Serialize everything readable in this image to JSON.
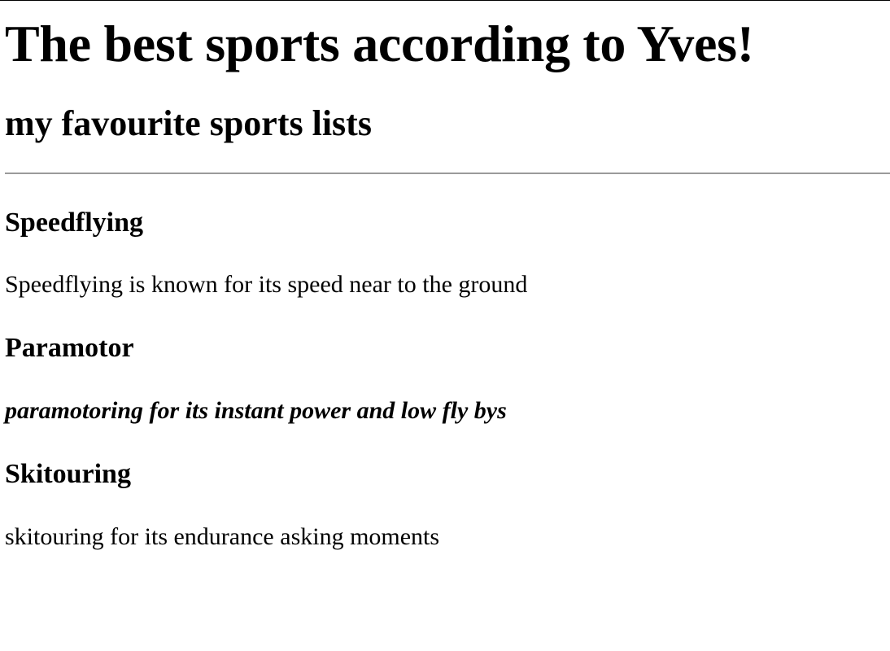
{
  "page": {
    "title": "The best sports according to Yves!",
    "subtitle": "my favourite sports lists"
  },
  "sections": [
    {
      "heading": "Speedflying",
      "text": "Speedflying is known for its speed near to the ground"
    },
    {
      "heading": "Paramotor",
      "text": "paramotoring for its instant power and low fly bys"
    },
    {
      "heading": "Skitouring",
      "text": "skitouring for its endurance asking moments"
    }
  ]
}
